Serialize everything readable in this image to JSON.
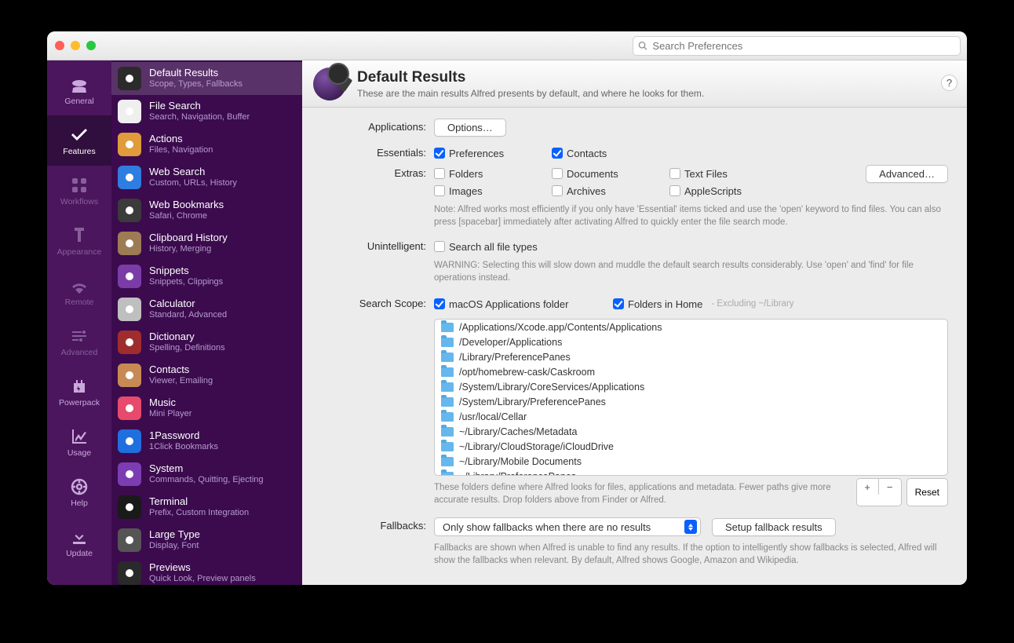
{
  "search_placeholder": "Search Preferences",
  "rail": [
    {
      "name": "general",
      "label": "General"
    },
    {
      "name": "features",
      "label": "Features"
    },
    {
      "name": "workflows",
      "label": "Workflows"
    },
    {
      "name": "appearance",
      "label": "Appearance"
    },
    {
      "name": "remote",
      "label": "Remote"
    },
    {
      "name": "advanced",
      "label": "Advanced"
    },
    {
      "name": "powerpack",
      "label": "Powerpack"
    },
    {
      "name": "usage",
      "label": "Usage"
    },
    {
      "name": "help",
      "label": "Help"
    },
    {
      "name": "update",
      "label": "Update"
    }
  ],
  "sidebar": [
    {
      "title": "Default Results",
      "sub": "Scope, Types, Fallbacks"
    },
    {
      "title": "File Search",
      "sub": "Search, Navigation, Buffer"
    },
    {
      "title": "Actions",
      "sub": "Files, Navigation"
    },
    {
      "title": "Web Search",
      "sub": "Custom, URLs, History"
    },
    {
      "title": "Web Bookmarks",
      "sub": "Safari, Chrome"
    },
    {
      "title": "Clipboard History",
      "sub": "History, Merging"
    },
    {
      "title": "Snippets",
      "sub": "Snippets, Clippings"
    },
    {
      "title": "Calculator",
      "sub": "Standard, Advanced"
    },
    {
      "title": "Dictionary",
      "sub": "Spelling, Definitions"
    },
    {
      "title": "Contacts",
      "sub": "Viewer, Emailing"
    },
    {
      "title": "Music",
      "sub": "Mini Player"
    },
    {
      "title": "1Password",
      "sub": "1Click Bookmarks"
    },
    {
      "title": "System",
      "sub": "Commands, Quitting, Ejecting"
    },
    {
      "title": "Terminal",
      "sub": "Prefix, Custom Integration"
    },
    {
      "title": "Large Type",
      "sub": "Display, Font"
    },
    {
      "title": "Previews",
      "sub": "Quick Look, Preview panels"
    }
  ],
  "header": {
    "title": "Default Results",
    "subtitle": "These are the main results Alfred presents by default, and where he looks for them."
  },
  "labels": {
    "applications": "Applications:",
    "essentials": "Essentials:",
    "extras": "Extras:",
    "unintelligent": "Unintelligent:",
    "search_scope": "Search Scope:",
    "fallbacks": "Fallbacks:"
  },
  "buttons": {
    "options": "Options…",
    "advanced": "Advanced…",
    "reset": "Reset",
    "setup_fallback": "Setup fallback results",
    "help": "?"
  },
  "essentials": [
    {
      "label": "Preferences",
      "checked": true
    },
    {
      "label": "Contacts",
      "checked": true
    }
  ],
  "extras": [
    {
      "label": "Folders",
      "checked": false
    },
    {
      "label": "Documents",
      "checked": false
    },
    {
      "label": "Text Files",
      "checked": false
    },
    {
      "label": "Images",
      "checked": false
    },
    {
      "label": "Archives",
      "checked": false
    },
    {
      "label": "AppleScripts",
      "checked": false
    }
  ],
  "extras_note": "Note: Alfred works most efficiently if you only have 'Essential' items ticked and use the 'open' keyword to find files. You can also press [spacebar] immediately after activating Alfred to quickly enter the file search mode.",
  "unintelligent": {
    "label": "Search all file types",
    "checked": false,
    "note": "WARNING: Selecting this will slow down and muddle the default search results considerably. Use 'open' and 'find' for file operations instead."
  },
  "scope": {
    "macos": {
      "label": "macOS Applications folder",
      "checked": true
    },
    "home": {
      "label": "Folders in Home",
      "checked": true,
      "excl": "- Excluding ~/Library"
    },
    "paths": [
      "/Applications/Xcode.app/Contents/Applications",
      "/Developer/Applications",
      "/Library/PreferencePanes",
      "/opt/homebrew-cask/Caskroom",
      "/System/Library/CoreServices/Applications",
      "/System/Library/PreferencePanes",
      "/usr/local/Cellar",
      "~/Library/Caches/Metadata",
      "~/Library/CloudStorage/iCloudDrive",
      "~/Library/Mobile Documents",
      "~/Library/PreferencePanes"
    ],
    "note": "These folders define where Alfred looks for files, applications and metadata. Fewer paths give more accurate results. Drop folders above from Finder or Alfred."
  },
  "fallbacks": {
    "select": "Only show fallbacks when there are no results",
    "note": "Fallbacks are shown when Alfred is unable to find any results. If the option to intelligently show fallbacks is selected, Alfred will show the fallbacks when relevant. By default, Alfred shows Google, Amazon and Wikipedia."
  }
}
